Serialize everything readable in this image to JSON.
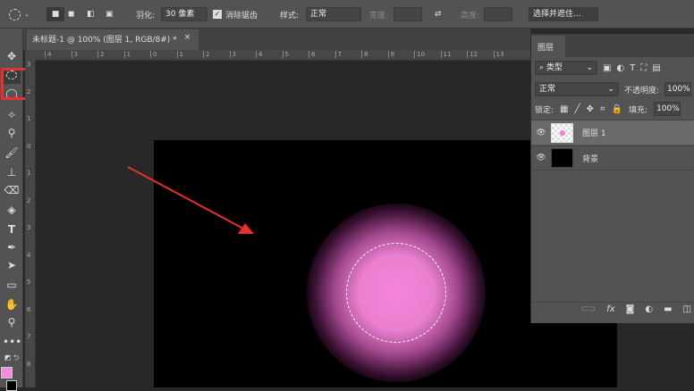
{
  "options": {
    "feather_label": "羽化:",
    "feather_value": "30 像素",
    "antialias_label": "消除锯齿",
    "antialias_checked": true,
    "style_label": "样式:",
    "style_value": "正常",
    "width_label": "宽度:",
    "height_label": "高度:",
    "select_mask_label": "选择并遮住..."
  },
  "document": {
    "tab_title": "未标题-1 @ 100% (图层 1, RGB/8#) *",
    "close": "×"
  },
  "rulers": {
    "h": [
      "4",
      "3",
      "2",
      "1",
      "0",
      "1",
      "2",
      "3",
      "4",
      "5",
      "6",
      "7",
      "8",
      "9",
      "10",
      "11",
      "12",
      "13"
    ],
    "v": [
      "3",
      "2",
      "1",
      "0",
      "1",
      "2",
      "3",
      "4",
      "5",
      "6",
      "7",
      "8"
    ]
  },
  "layers_panel": {
    "title": "图层",
    "filter_label": "类型",
    "blend_mode": "正常",
    "opacity_label": "不透明度:",
    "opacity_value": "100%",
    "lock_label": "锁定:",
    "fill_label": "填充:",
    "fill_value": "100%",
    "layers": [
      {
        "name": "图层 1",
        "selected": true
      },
      {
        "name": "背景",
        "selected": false
      }
    ]
  },
  "colors": {
    "foreground": "#f58be0",
    "background": "#000000",
    "accent_red": "#e8312f",
    "glow": "#f080d8"
  }
}
